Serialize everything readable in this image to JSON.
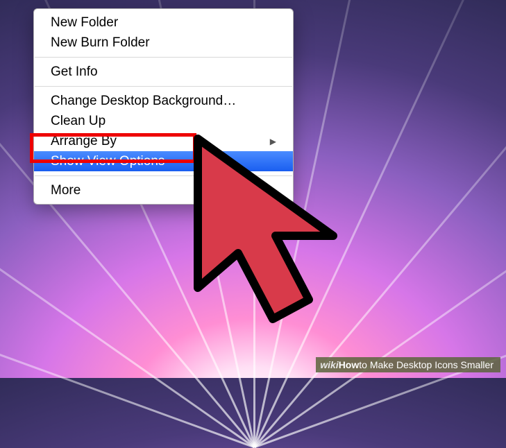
{
  "menu": {
    "items": [
      {
        "label": "New Folder",
        "highlighted": false,
        "has_submenu": false
      },
      {
        "label": "New Burn Folder",
        "highlighted": false,
        "has_submenu": false
      }
    ],
    "group2": [
      {
        "label": "Get Info",
        "highlighted": false,
        "has_submenu": false
      }
    ],
    "group3": [
      {
        "label": "Change Desktop Background…",
        "highlighted": false,
        "has_submenu": false
      },
      {
        "label": "Clean Up",
        "highlighted": false,
        "has_submenu": false
      },
      {
        "label": "Arrange By",
        "highlighted": false,
        "has_submenu": true
      },
      {
        "label": "Show View Options",
        "highlighted": true,
        "has_submenu": false
      }
    ],
    "group4": [
      {
        "label": "More",
        "highlighted": false,
        "has_submenu": false
      }
    ]
  },
  "footer": {
    "brand_prefix": "wiki",
    "brand_suffix": "How",
    "title": " to Make Desktop Icons Smaller"
  }
}
